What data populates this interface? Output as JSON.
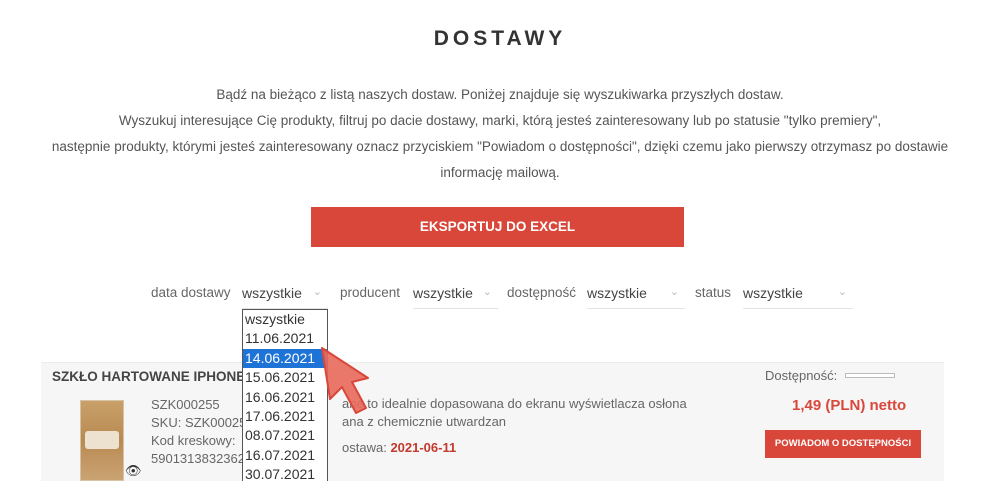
{
  "page": {
    "title": "DOSTAWY",
    "intro_lines": [
      "Bądź na bieżąco z listą naszych dostaw. Poniżej znajduje się wyszukiwarka przyszłych dostaw.",
      "Wyszukuj interesujące Cię produkty, filtruj po dacie dostawy, marki, którą jesteś zainteresowany lub po statusie \"tylko premiery\",",
      "następnie produkty, którymi jesteś zainteresowany oznacz przyciskiem \"Powiadom o dostępności\", dzięki czemu jako pierwszy otrzymasz po dostawie",
      "informację mailową."
    ],
    "export_label": "EKSPORTUJ DO EXCEL"
  },
  "filters": {
    "date": {
      "label": "data dostawy",
      "value": "wszystkie"
    },
    "producer": {
      "label": "producent",
      "value": "wszystkie"
    },
    "availability": {
      "label": "dostępność",
      "value": "wszystkie"
    },
    "status": {
      "label": "status",
      "value": "wszystkie"
    }
  },
  "date_dropdown": {
    "options": [
      "wszystkie",
      "11.06.2021",
      "14.06.2021",
      "15.06.2021",
      "16.06.2021",
      "17.06.2021",
      "08.07.2021",
      "16.07.2021",
      "30.07.2021"
    ],
    "highlighted": "14.06.2021"
  },
  "product": {
    "name": "SZKŁO HARTOWANE IPHONE",
    "code": "SZK000255",
    "sku": "SKU: SZK00025",
    "barcode_label": "Kod kreskowy:",
    "barcode": "5901313832362",
    "desc_line1": "ane to idealnie dopasowana do ekranu wyświetlacza osłona",
    "desc_line2": "ana z chemicznie utwardzan",
    "ship_label": "ostawa:",
    "ship_date": "2021-06-11",
    "availability_label": "Dostępność:",
    "price": "1,49 (PLN) netto",
    "notify_label": "POWIADOM O DOSTĘPNOŚCI"
  },
  "colors": {
    "accent": "#d9473a",
    "selection": "#1e73d6",
    "cursor": "#e86a5c"
  },
  "icons": {
    "eye": "eye-icon",
    "chevron": "chevron-down-icon",
    "cursor": "pointer-cursor-icon"
  }
}
